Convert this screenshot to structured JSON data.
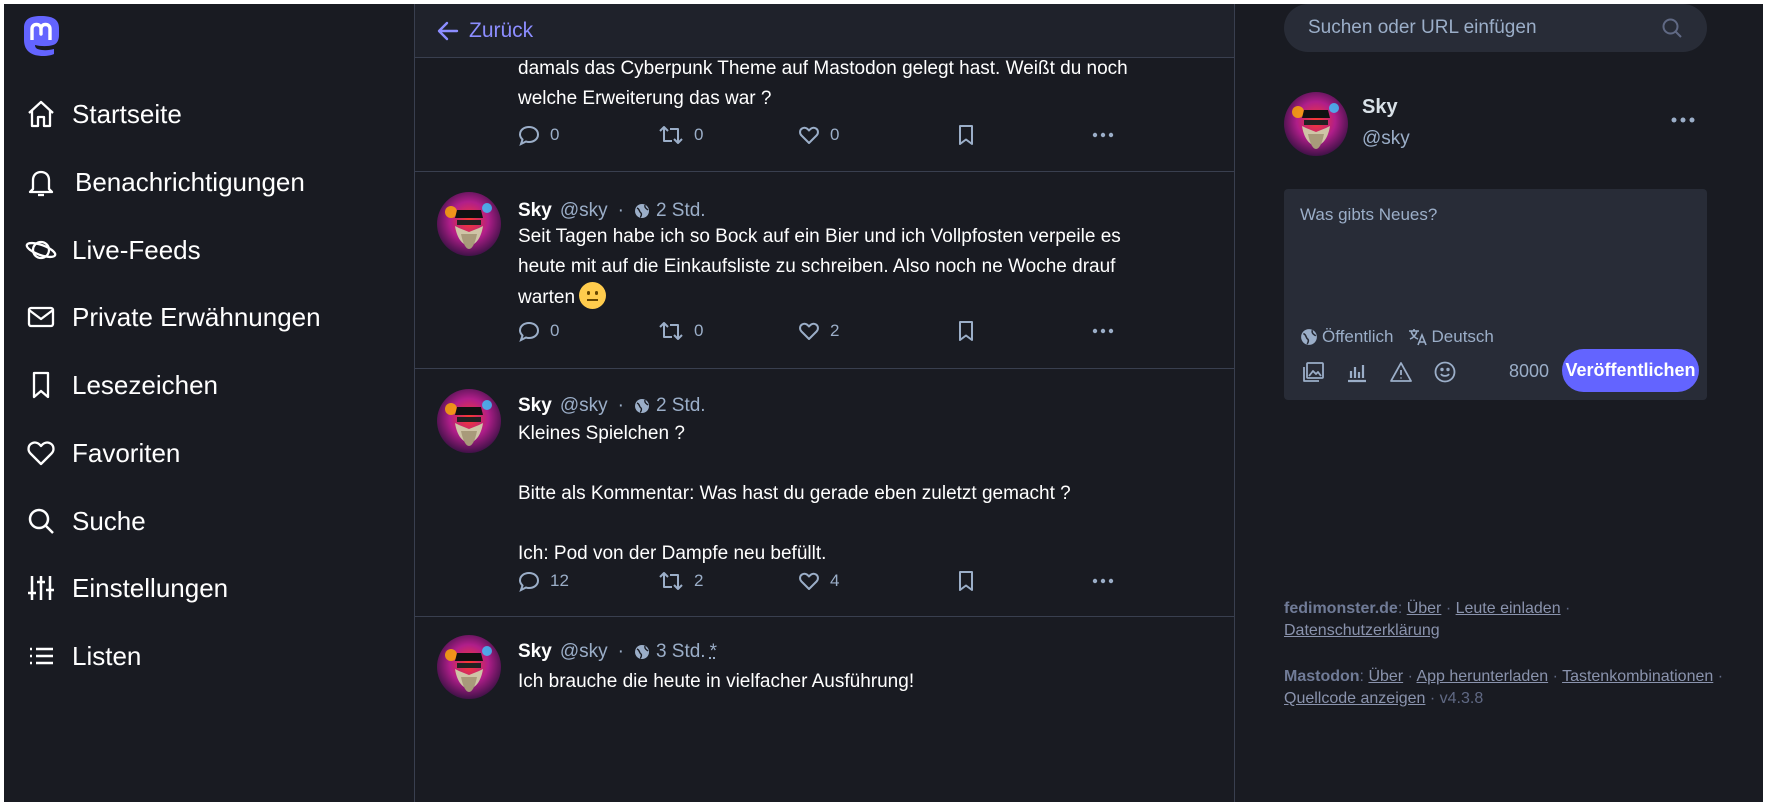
{
  "nav": {
    "items": [
      {
        "label": "Startseite",
        "icon": "home-icon"
      },
      {
        "label": "Benachrichtigungen",
        "icon": "bell-icon"
      },
      {
        "label": "Live-Feeds",
        "icon": "planet-icon"
      },
      {
        "label": "Private Erwähnungen",
        "icon": "envelope-icon"
      },
      {
        "label": "Lesezeichen",
        "icon": "bookmark-icon"
      },
      {
        "label": "Favoriten",
        "icon": "heart-icon"
      },
      {
        "label": "Suche",
        "icon": "search-icon"
      },
      {
        "label": "Einstellungen",
        "icon": "sliders-icon"
      },
      {
        "label": "Listen",
        "icon": "list-icon"
      }
    ]
  },
  "timeline": {
    "back_label": "Zurück",
    "posts": [
      {
        "name": "",
        "handle": "",
        "time": "",
        "lines": [
          "damals das Cyberpunk Theme auf Mastodon gelegt hast. Weißt du noch",
          "welche Erweiterung das war ?"
        ],
        "replies": "0",
        "boosts": "0",
        "favs": "0"
      },
      {
        "name": "Sky",
        "handle": "@sky",
        "time": "2 Std.",
        "lines": [
          "Seit Tagen habe ich so Bock auf ein Bier und ich Vollpfosten verpeile es",
          "heute mit auf die Einkaufsliste zu schreiben. Also noch ne Woche drauf",
          "warten"
        ],
        "emoji": "neutral-face-emoji",
        "replies": "0",
        "boosts": "0",
        "favs": "2"
      },
      {
        "name": "Sky",
        "handle": "@sky",
        "time": "2 Std.",
        "lines": [
          "Kleines Spielchen ?",
          "",
          "Bitte als Kommentar: Was hast du gerade eben zuletzt gemacht ?",
          "",
          "Ich: Pod von der Dampfe neu befüllt."
        ],
        "replies": "12",
        "boosts": "2",
        "favs": "4"
      },
      {
        "name": "Sky",
        "handle": "@sky",
        "time": "3 Std.",
        "edited_mark": "*",
        "lines": [
          "Ich brauche die heute in vielfacher Ausführung!"
        ]
      }
    ]
  },
  "right": {
    "search_placeholder": "Suchen oder URL einfügen",
    "profile": {
      "name": "Sky",
      "handle": "@sky"
    },
    "compose": {
      "placeholder": "Was gibts Neues?",
      "visibility": "Öffentlich",
      "language": "Deutsch",
      "counter": "8000",
      "publish_label": "Veröffentlichen"
    },
    "footer": {
      "server": "fedimonster.de",
      "server_links": [
        "Über",
        "Leute einladen",
        "Datenschutzerklärung"
      ],
      "app": "Mastodon",
      "app_links": [
        "Über",
        "App herunterladen",
        "Tastenkombinationen",
        "Quellcode anzeigen"
      ],
      "version": "v4.3.8"
    }
  },
  "colors": {
    "background": "#191b22",
    "accent": "#6364ff",
    "link": "#8c8dff",
    "muted": "#9baec8"
  }
}
